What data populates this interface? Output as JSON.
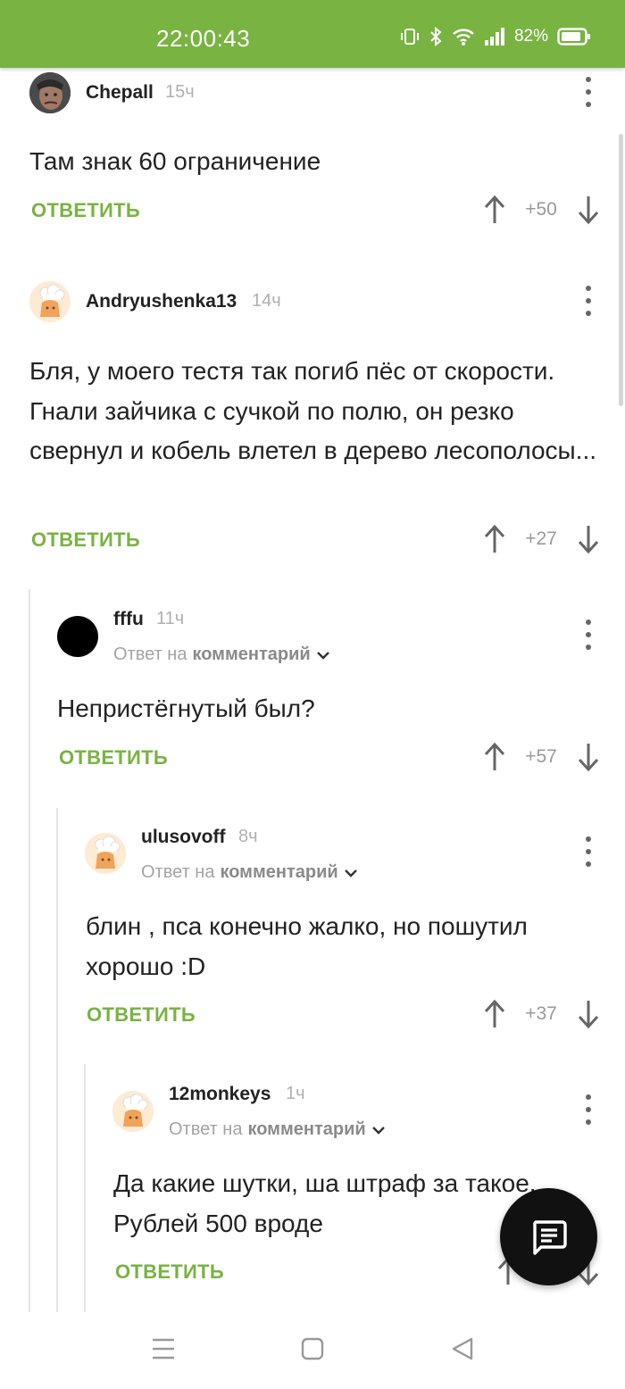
{
  "status_bar": {
    "time": "22:00:43",
    "battery": "82%",
    "bg_color": "#79b342"
  },
  "accent_color": "#79b342",
  "comments": [
    {
      "username": "Chepall",
      "time": "15ч",
      "text": "Там знак 60 ограничение",
      "reply_label": "ОТВЕТИТЬ",
      "rating": "+50",
      "avatar": "photo-avatar"
    },
    {
      "username": "Andryushenka13",
      "time": "14ч",
      "text": "Бля, у моего тестя так погиб пёс от скорости. Гнали зайчика с сучкой по полю, он резко свернул и кобель влетел в дерево лесополосы...",
      "reply_label": "ОТВЕТИТЬ",
      "rating": "+27",
      "avatar": "chef-avatar"
    },
    {
      "username": "fffu",
      "time": "11ч",
      "reply_prefix": "Ответ на",
      "reply_target": "комментарий",
      "text": "Непристёгнутый был?",
      "reply_label": "ОТВЕТИТЬ",
      "rating": "+57",
      "avatar": "black-avatar"
    },
    {
      "username": "ulusovoff",
      "time": "8ч",
      "reply_prefix": "Ответ на",
      "reply_target": "комментарий",
      "text": "блин , пса конечно жалко, но пошутил хорошо :D",
      "reply_label": "ОТВЕТИТЬ",
      "rating": "+37",
      "avatar": "chef-avatar"
    },
    {
      "username": "12monkeys",
      "time": "1ч",
      "reply_prefix": "Ответ на",
      "reply_target": "комментарий",
      "text": "Да какие шутки, ша штраф за такое. Рублей 500 вроде",
      "reply_label": "ОТВЕТИТЬ",
      "avatar": "chef-avatar"
    }
  ],
  "fab": {
    "icon": "comment-icon"
  },
  "nav_bar": {
    "icons": [
      "menu-icon",
      "home-icon",
      "back-icon"
    ]
  }
}
